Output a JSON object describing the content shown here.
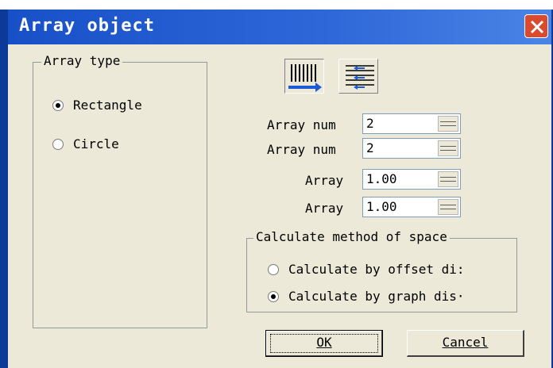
{
  "window": {
    "title": "Array object"
  },
  "array_type": {
    "label": "Array type",
    "options": [
      {
        "label": "Rectangle",
        "checked": true
      },
      {
        "label": "Circle",
        "checked": false
      }
    ]
  },
  "toolbar": {
    "horizontal_icon": "vertical-lines-arrow-icon",
    "vertical_icon": "horizontal-lines-arrows-icon"
  },
  "fields": [
    {
      "label": "Array num",
      "value": "2"
    },
    {
      "label": "Array num",
      "value": "2"
    },
    {
      "label": "Array",
      "value": "1.00"
    },
    {
      "label": "Array",
      "value": "1.00"
    }
  ],
  "calc_method": {
    "label": "Calculate method of space",
    "options": [
      {
        "label": "Calculate by offset di:",
        "checked": false
      },
      {
        "label": "Calculate by graph dis·",
        "checked": true
      }
    ]
  },
  "buttons": {
    "ok": "OK",
    "cancel": "Cancel"
  },
  "colors": {
    "titlebar": "#2f68d8",
    "dialog_bg": "#ece9d8",
    "close": "#d94a2f",
    "accent_blue": "#1c5ad8"
  }
}
